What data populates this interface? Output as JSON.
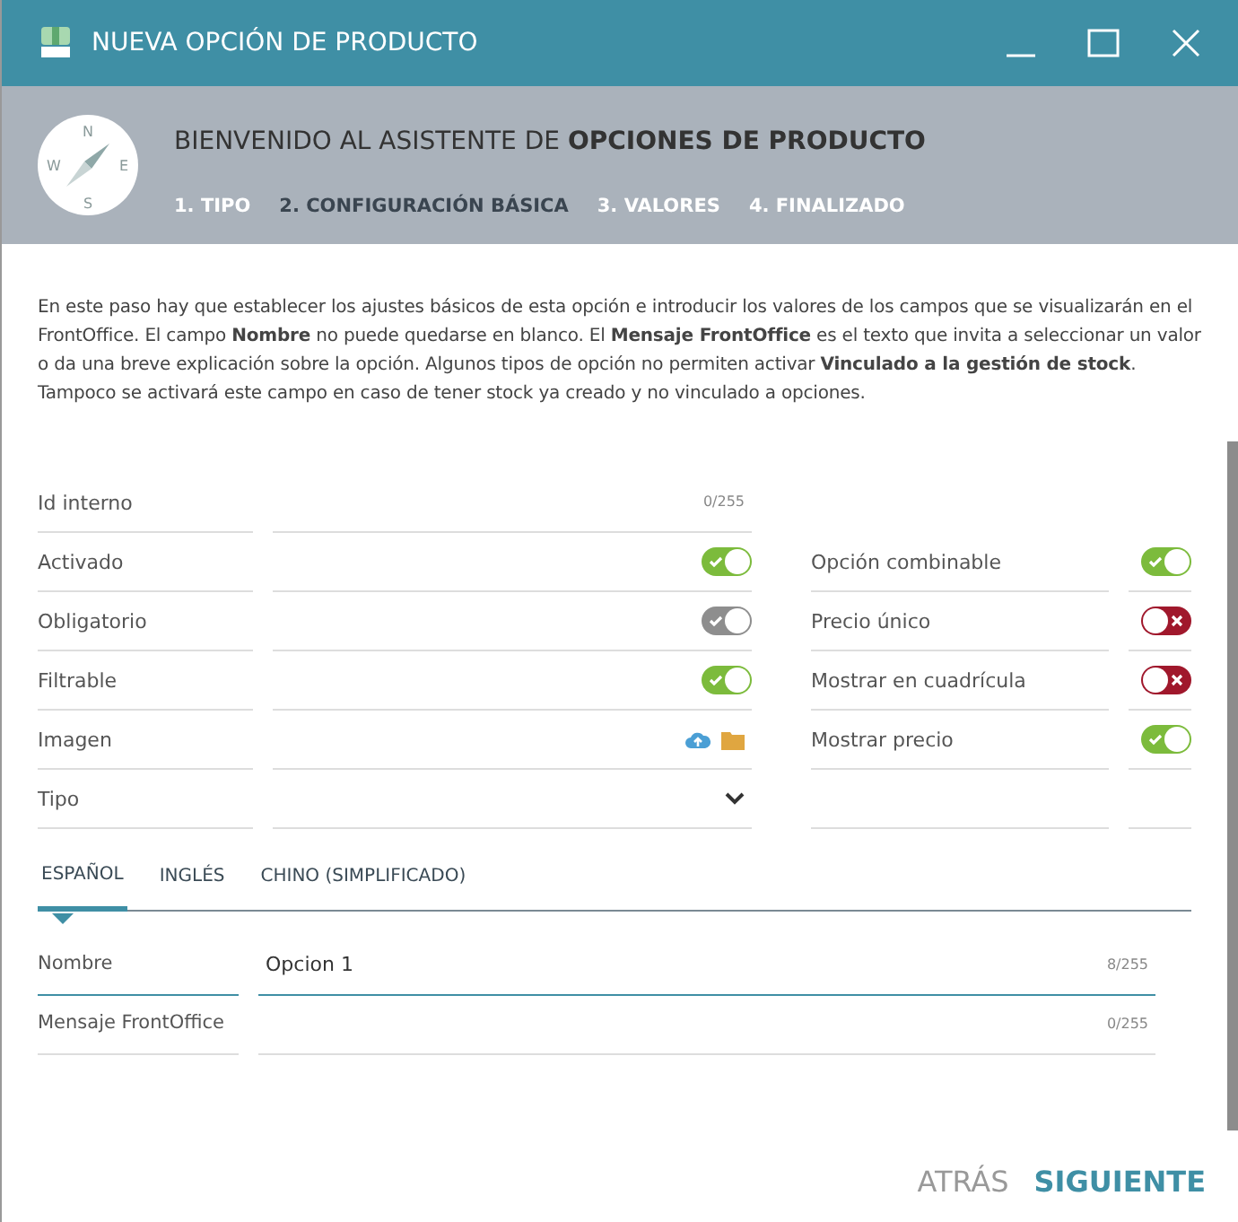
{
  "window": {
    "title": "NUEVA OPCIÓN DE PRODUCTO"
  },
  "header": {
    "welcome": "BIENVENIDO AL ASISTENTE DE **OPCIONES DE PRODUCTO**",
    "compass": [
      "N",
      "E",
      "S",
      "W"
    ],
    "steps": [
      {
        "label": "1. TIPO",
        "selected": false
      },
      {
        "label": "2. CONFIGURACIÓN BÁSICA",
        "selected": true
      },
      {
        "label": "3. VALORES",
        "selected": false
      },
      {
        "label": "4. FINALIZADO",
        "selected": false
      }
    ]
  },
  "intro": "En este paso hay que establecer los ajustes básicos de esta opción e introducir los valores de los campos que se visualizarán en el FrontOffice. El campo **Nombre** no puede quedarse en blanco. El **Mensaje FrontOffice** es el texto que invita a seleccionar un valor o da una breve explicación sobre la opción. Algunos tipos de opción no permiten activar **Vinculado a la gestión de stock**. Tampoco se activará este campo en caso de tener stock ya creado y no vinculado a opciones.",
  "left_fields": [
    {
      "kind": "text",
      "label": "Id interno",
      "counter": "0/255"
    },
    {
      "kind": "toggle",
      "label": "Activado",
      "on": true,
      "disabled": false
    },
    {
      "kind": "toggle",
      "label": "Obligatorio",
      "on": true,
      "disabled": true
    },
    {
      "kind": "toggle",
      "label": "Filtrable",
      "on": true,
      "disabled": false
    },
    {
      "kind": "file",
      "label": "Imagen"
    },
    {
      "kind": "select",
      "label": "Tipo"
    }
  ],
  "right_fields": [
    {
      "label": "Opción combinable",
      "on": true,
      "disabled": false
    },
    {
      "label": "Precio único",
      "on": false,
      "disabled": false
    },
    {
      "label": "Mostrar en cuadrícula",
      "on": false,
      "disabled": false
    },
    {
      "label": "Mostrar precio",
      "on": true,
      "disabled": false
    }
  ],
  "language_tabs": [
    {
      "label": "ESPAÑOL",
      "selected": true
    },
    {
      "label": "INGLÉS",
      "selected": false
    },
    {
      "label": "CHINO (SIMPLIFICADO)",
      "selected": false
    }
  ],
  "language_fields": [
    {
      "label": "Nombre",
      "value": "Opcion 1",
      "counter": "8/255",
      "focused": true
    },
    {
      "label": "Mensaje FrontOffice",
      "counter": "0/255",
      "focused": false
    }
  ],
  "buttons": [
    {
      "label": "ATRÁS",
      "primary": false
    },
    {
      "label": "SIGUIENTE",
      "primary": true
    }
  ]
}
